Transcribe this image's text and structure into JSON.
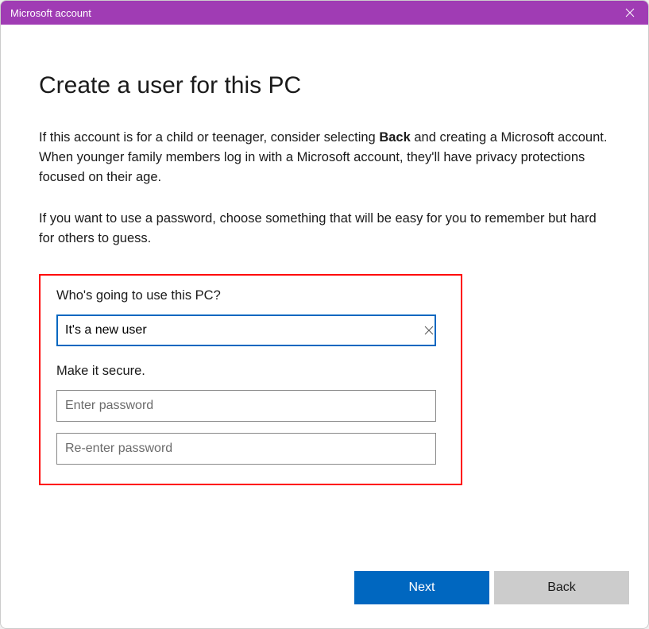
{
  "titlebar": {
    "title": "Microsoft account"
  },
  "main": {
    "heading": "Create a user for this PC",
    "paragraph1_pre": "If this account is for a child or teenager, consider selecting ",
    "paragraph1_bold": "Back",
    "paragraph1_post": " and creating a Microsoft account. When younger family members log in with a Microsoft account, they'll have privacy protections focused on their age.",
    "paragraph2": "If you want to use a password, choose something that will be easy for you to remember but hard for others to guess."
  },
  "form": {
    "username_label": "Who's going to use this PC?",
    "username_value": "It's a new user",
    "password_label": "Make it secure.",
    "password_placeholder": "Enter password",
    "confirm_placeholder": "Re-enter password"
  },
  "buttons": {
    "next": "Next",
    "back": "Back"
  }
}
